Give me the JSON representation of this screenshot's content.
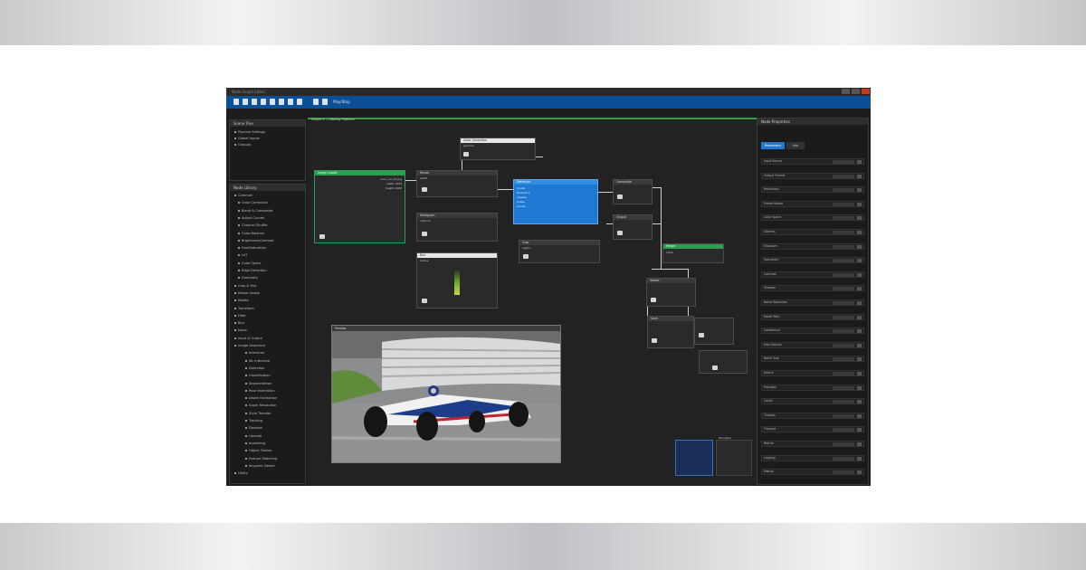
{
  "window": {
    "title": "Node Graph Editor"
  },
  "toolbar": {
    "label": "Play/Stop"
  },
  "left_top_panel": {
    "title": "Scene Tree",
    "items": [
      "Pipeline Settings",
      "Global Inputs",
      "Outputs"
    ]
  },
  "left_panel": {
    "title": "Node Library",
    "items": [
      "Common",
      "Color Correction",
      "Blend & Composite",
      "Adjust Curves",
      "Channel Shuffle",
      "Color Balance",
      "Brightness/Contrast",
      "Hue/Saturation",
      "LUT",
      "Color Space",
      "Edge Detection",
      "Geometry",
      "Crop & Pad",
      "Resize Image",
      "Rotate",
      "Transform",
      "Filter",
      "Blur",
      "Noise",
      "Input & Output",
      "Image Sequence",
      "Inference",
      "ML Inference",
      "Detection",
      "Classification",
      "Segmentation",
      "Pose Estimation",
      "Depth Estimation",
      "Super Resolution",
      "Style Transfer",
      "Tracking",
      "Denoise",
      "Upscale",
      "Inpainting",
      "Object Tracker",
      "Feature Matching",
      "Keypoint Detect",
      "Utility"
    ]
  },
  "canvas": {
    "tab_label": "Graph 1 — Racing Pipeline"
  },
  "nodes": [
    {
      "title": "Image Loader",
      "rows": [
        "race_car_01.jpg",
        "width 1920",
        "height 1080"
      ]
    },
    {
      "title": "Resize",
      "rows": [
        "width",
        "height",
        "mode"
      ]
    },
    {
      "title": "Color Correction",
      "rows": [
        "gamma",
        "gain",
        "lift"
      ]
    },
    {
      "title": "Histogram",
      "rows": [
        "channel"
      ]
    },
    {
      "title": "Detection",
      "rows": [
        "model",
        "threshold",
        "classes",
        "boxes",
        "scores"
      ]
    },
    {
      "title": "Crop",
      "rows": [
        "region"
      ]
    },
    {
      "title": "Blur",
      "rows": [
        "radius"
      ]
    },
    {
      "title": "Composite",
      "rows": [
        "A",
        "B"
      ]
    },
    {
      "title": "Output",
      "rows": [
        "path"
      ]
    },
    {
      "title": "Merge",
      "rows": [
        "input"
      ]
    },
    {
      "title": "Viewer",
      "rows": [
        "image"
      ]
    },
    {
      "title": "Save",
      "rows": [
        "file"
      ]
    }
  ],
  "viewer": {
    "title": "Preview"
  },
  "thumbnail_panel": {
    "title": "Navigator"
  },
  "right_panel": {
    "title": "Node Properties",
    "tabs": [
      "Parameters",
      "Info"
    ],
    "rows": [
      "Input Source",
      "Output Format",
      "Resolution",
      "Frame Range",
      "Color Space",
      "Gamma",
      "Exposure",
      "Saturation",
      "Contrast",
      "Sharpen",
      "Noise Reduction",
      "Model Path",
      "Confidence",
      "Max Objects",
      "Batch Size",
      "Device",
      "Precision",
      "Cache",
      "Threads",
      "Timeout",
      "Retries",
      "Logging",
      "Debug"
    ]
  },
  "colors": {
    "accent": "#0b4f96",
    "graph_border": "#2f9e44",
    "selected_node": "#1f78d1"
  }
}
